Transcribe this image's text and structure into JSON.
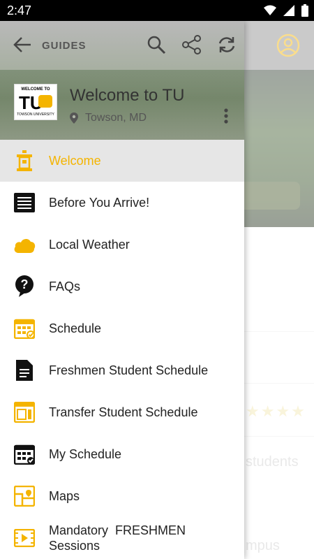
{
  "status": {
    "time": "2:47"
  },
  "header": {
    "section_label": "GUIDES",
    "guide_title": "Welcome to TU",
    "location": "Towson, MD",
    "logo": {
      "line1": "WELCOME TO",
      "line2": "TU",
      "line3": "TOWSON UNIVERSITY"
    }
  },
  "menu": {
    "items": [
      {
        "label": "Welcome",
        "icon": "podium-icon"
      },
      {
        "label": "Before You Arrive!",
        "icon": "list-icon"
      },
      {
        "label": "Local Weather",
        "icon": "cloud-icon"
      },
      {
        "label": "FAQs",
        "icon": "question-icon"
      },
      {
        "label": "Schedule",
        "icon": "calendar-icon"
      },
      {
        "label": "Freshmen Student Schedule",
        "icon": "document-icon"
      },
      {
        "label": "Transfer Student Schedule",
        "icon": "layout-icon"
      },
      {
        "label": "My Schedule",
        "icon": "calendar-check-icon"
      },
      {
        "label": "Maps",
        "icon": "map-icon"
      },
      {
        "label": "Mandatory  FRESHMEN",
        "label2": "Sessions",
        "icon": "video-icon"
      }
    ]
  },
  "background": {
    "text1": "students",
    "text2": "mpus"
  },
  "colors": {
    "accent": "#f4b400",
    "text": "#222222"
  }
}
